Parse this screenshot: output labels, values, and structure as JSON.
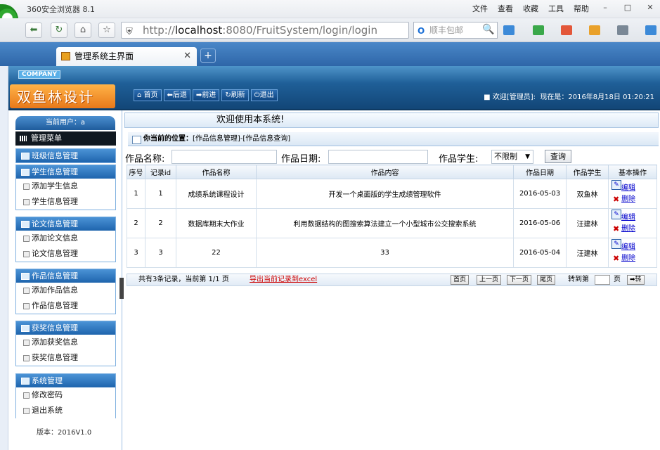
{
  "browser": {
    "title": "360安全浏览器 8.1",
    "menu": [
      "文件",
      "查看",
      "收藏",
      "工具",
      "帮助"
    ],
    "url_scheme": "http://",
    "url_host": "localhost",
    "url_path": ":8080/FruitSystem/login/login",
    "search_placeholder": "顺丰包邮",
    "tab_title": "管理系统主界面"
  },
  "app": {
    "company_tag": "COMPANY",
    "logo_text": "双鱼林设计",
    "nav": [
      "首页",
      "后退",
      "前进",
      "刷新",
      "退出"
    ],
    "welcome_user": "欢迎[管理员]",
    "current_time": "现在是：2016年8月18日 01:20:21"
  },
  "sidebar": {
    "current_user": "当前用户：a",
    "menu_title": "管理菜单",
    "groups": [
      {
        "title": "班级信息管理",
        "items": []
      },
      {
        "title": "学生信息管理",
        "items": [
          "添加学生信息",
          "学生信息管理"
        ]
      },
      {
        "title": "论文信息管理",
        "items": [
          "添加论文信息",
          "论文信息管理"
        ]
      },
      {
        "title": "作品信息管理",
        "items": [
          "添加作品信息",
          "作品信息管理"
        ]
      },
      {
        "title": "获奖信息管理",
        "items": [
          "添加获奖信息",
          "获奖信息管理"
        ]
      },
      {
        "title": "系统管理",
        "items": [
          "修改密码",
          "退出系统"
        ]
      }
    ],
    "version": "版本：2016V1.0"
  },
  "main": {
    "welcome": "欢迎使用本系统!",
    "breadcrumb_label": "你当前的位置：",
    "breadcrumb_path": "[作品信息管理]-[作品信息查询]",
    "search": {
      "name_label": "作品名称:",
      "date_label": "作品日期:",
      "student_label": "作品学生:",
      "student_value": "不限制",
      "query_button": "查询"
    },
    "table": {
      "headers": [
        "序号",
        "记录id",
        "作品名称",
        "作品内容",
        "作品日期",
        "作品学生",
        "基本操作"
      ],
      "rows": [
        [
          "1",
          "1",
          "成绩系统课程设计",
          "开发一个桌面版的学生成绩管理软件",
          "2016-05-03",
          "双鱼林"
        ],
        [
          "2",
          "2",
          "数据库期末大作业",
          "利用数据结构的图搜索算法建立一个小型城市公交搜索系统",
          "2016-05-06",
          "汪建林"
        ],
        [
          "3",
          "3",
          "22",
          "33",
          "2016-05-04",
          "汪建林"
        ]
      ],
      "edit_label": "编辑",
      "delete_label": "删除"
    },
    "pager": {
      "summary": "共有3条记录，当前第 1/1 页",
      "export": "导出当前记录到excel",
      "first": "首页",
      "prev": "上一页",
      "next": "下一页",
      "last": "尾页",
      "goto": "转到第",
      "unit": "页",
      "go": "➡转"
    }
  }
}
